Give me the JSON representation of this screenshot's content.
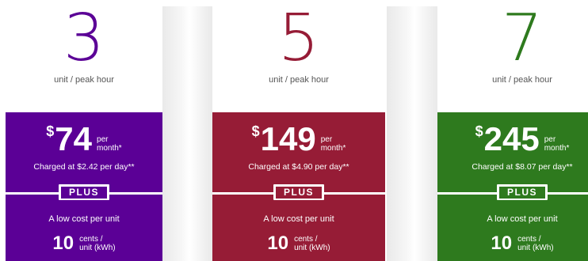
{
  "cards": [
    {
      "units": "3",
      "unit_label": "unit / peak hour",
      "currency": "$",
      "price": "74",
      "per_line1": "per",
      "per_line2": "month*",
      "charged": "Charged at $2.42 per day**",
      "badge": "PLUS",
      "low_cost": "A low cost per unit",
      "cents": "10",
      "cents_line1": "cents /",
      "cents_line2": "unit (kWh)",
      "color": "#5b0096"
    },
    {
      "units": "5",
      "unit_label": "unit / peak hour",
      "currency": "$",
      "price": "149",
      "per_line1": "per",
      "per_line2": "month*",
      "charged": "Charged at $4.90 per day**",
      "badge": "PLUS",
      "low_cost": "A low cost per unit",
      "cents": "10",
      "cents_line1": "cents /",
      "cents_line2": "unit (kWh)",
      "color": "#961c36"
    },
    {
      "units": "7",
      "unit_label": "unit / peak hour",
      "currency": "$",
      "price": "245",
      "per_line1": "per",
      "per_line2": "month*",
      "charged": "Charged at $8.07 per day**",
      "badge": "PLUS",
      "low_cost": "A low cost per unit",
      "cents": "10",
      "cents_line1": "cents /",
      "cents_line2": "unit (kWh)",
      "color": "#2e7a1e"
    }
  ]
}
